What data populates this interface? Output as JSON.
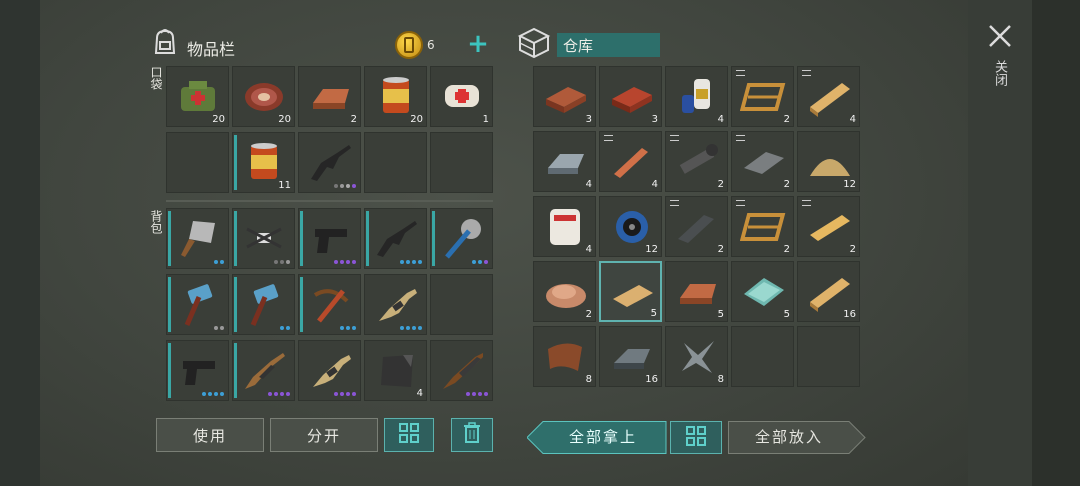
{
  "inventory": {
    "title": "物品栏",
    "coins": "6",
    "plus": "+",
    "pocket_label": "口袋",
    "backpack_label": "背包",
    "pocket": [
      {
        "icon": "medkit-bag-icon",
        "count": "20"
      },
      {
        "icon": "steak-icon",
        "count": "20"
      },
      {
        "icon": "copper-ingot-icon",
        "count": "2"
      },
      {
        "icon": "canned-food-icon",
        "count": "20"
      },
      {
        "icon": "bandage-icon",
        "count": "1"
      },
      {
        "icon": "empty-slot",
        "count": ""
      },
      {
        "icon": "canned-food-icon",
        "count": "11"
      },
      {
        "icon": "assault-rifle-icon",
        "count": "",
        "dots": [
          "#777",
          "#999",
          "#aaa",
          "#8b55d6"
        ]
      },
      {
        "icon": "empty-slot",
        "count": ""
      },
      {
        "icon": "empty-slot",
        "count": ""
      }
    ],
    "backpack": [
      {
        "icon": "cleaver-icon",
        "count": "",
        "dots": [
          "#3d9fd6",
          "#3d9fd6"
        ]
      },
      {
        "icon": "drone-icon",
        "count": "",
        "dots": [
          "#777",
          "#777",
          "#999"
        ]
      },
      {
        "icon": "pistol-icon",
        "count": "",
        "dots": [
          "#8b55d6",
          "#8b55d6",
          "#8b55d6",
          "#8b55d6"
        ]
      },
      {
        "icon": "assault-rifle-icon",
        "count": "",
        "dots": [
          "#3d9fd6",
          "#3d9fd6",
          "#3d9fd6",
          "#3d9fd6"
        ]
      },
      {
        "icon": "saw-mace-icon",
        "count": "",
        "dots": [
          "#3d9fd6",
          "#3d9fd6",
          "#8b55d6"
        ]
      },
      {
        "icon": "sledgehammer-icon",
        "count": "",
        "dots": [
          "#999",
          "#999"
        ]
      },
      {
        "icon": "sledgehammer-icon",
        "count": "",
        "dots": [
          "#3d9fd6",
          "#3d9fd6"
        ]
      },
      {
        "icon": "crossbow-icon",
        "count": "",
        "dots": [
          "#3d9fd6",
          "#3d9fd6",
          "#3d9fd6"
        ]
      },
      {
        "icon": "bullpup-rifle-icon",
        "count": "",
        "dots": [
          "#3d9fd6",
          "#3d9fd6",
          "#3d9fd6",
          "#3d9fd6"
        ]
      },
      {
        "icon": "empty-slot",
        "count": ""
      },
      {
        "icon": "pistol-icon",
        "count": "",
        "dots": [
          "#3d9fd6",
          "#3d9fd6",
          "#3d9fd6",
          "#3d9fd6"
        ]
      },
      {
        "icon": "rifle-icon",
        "count": "",
        "dots": [
          "#8b55d6",
          "#8b55d6",
          "#8b55d6",
          "#8b55d6"
        ]
      },
      {
        "icon": "bullpup-rifle-icon",
        "count": "",
        "dots": [
          "#8b55d6",
          "#8b55d6",
          "#8b55d6",
          "#8b55d6"
        ]
      },
      {
        "icon": "rubber-sheet-icon",
        "count": "4"
      },
      {
        "icon": "shotgun-icon",
        "count": "",
        "dots": [
          "#8b55d6",
          "#8b55d6",
          "#8b55d6",
          "#8b55d6"
        ]
      }
    ],
    "buttons": {
      "use": "使用",
      "split": "分开"
    }
  },
  "storage": {
    "title": "仓库",
    "items": [
      {
        "icon": "brick-icon",
        "count": "3"
      },
      {
        "icon": "red-brick-icon",
        "count": "3"
      },
      {
        "icon": "glue-bottles-icon",
        "count": "4"
      },
      {
        "icon": "wood-frame-icon",
        "count": "2"
      },
      {
        "icon": "wood-plank-icon",
        "count": "4"
      },
      {
        "icon": "iron-ingot-icon",
        "count": "4"
      },
      {
        "icon": "copper-wire-icon",
        "count": "4"
      },
      {
        "icon": "pipe-icon",
        "count": "2"
      },
      {
        "icon": "metal-sheet-icon",
        "count": "2"
      },
      {
        "icon": "sand-pile-icon",
        "count": "12"
      },
      {
        "icon": "asbestos-bag-icon",
        "count": "4"
      },
      {
        "icon": "wire-spool-icon",
        "count": "12"
      },
      {
        "icon": "metal-bar-icon",
        "count": "2"
      },
      {
        "icon": "wood-frame-icon",
        "count": "2"
      },
      {
        "icon": "wood-beam-icon",
        "count": "2"
      },
      {
        "icon": "wood-chips-icon",
        "count": "2"
      },
      {
        "icon": "wood-board-icon",
        "count": "5"
      },
      {
        "icon": "copper-ingot-icon",
        "count": "5"
      },
      {
        "icon": "glass-icon",
        "count": "5"
      },
      {
        "icon": "wood-plank-icon",
        "count": "16"
      },
      {
        "icon": "leather-icon",
        "count": "8"
      },
      {
        "icon": "steel-ingot-icon",
        "count": "16"
      },
      {
        "icon": "scrap-metal-icon",
        "count": "8"
      },
      {
        "icon": "empty-slot",
        "count": ""
      },
      {
        "icon": "empty-slot",
        "count": ""
      }
    ],
    "buttons": {
      "take_all": "全部拿上",
      "put_all": "全部放入"
    }
  },
  "close": {
    "icon": "close-icon",
    "label": "关闭"
  }
}
